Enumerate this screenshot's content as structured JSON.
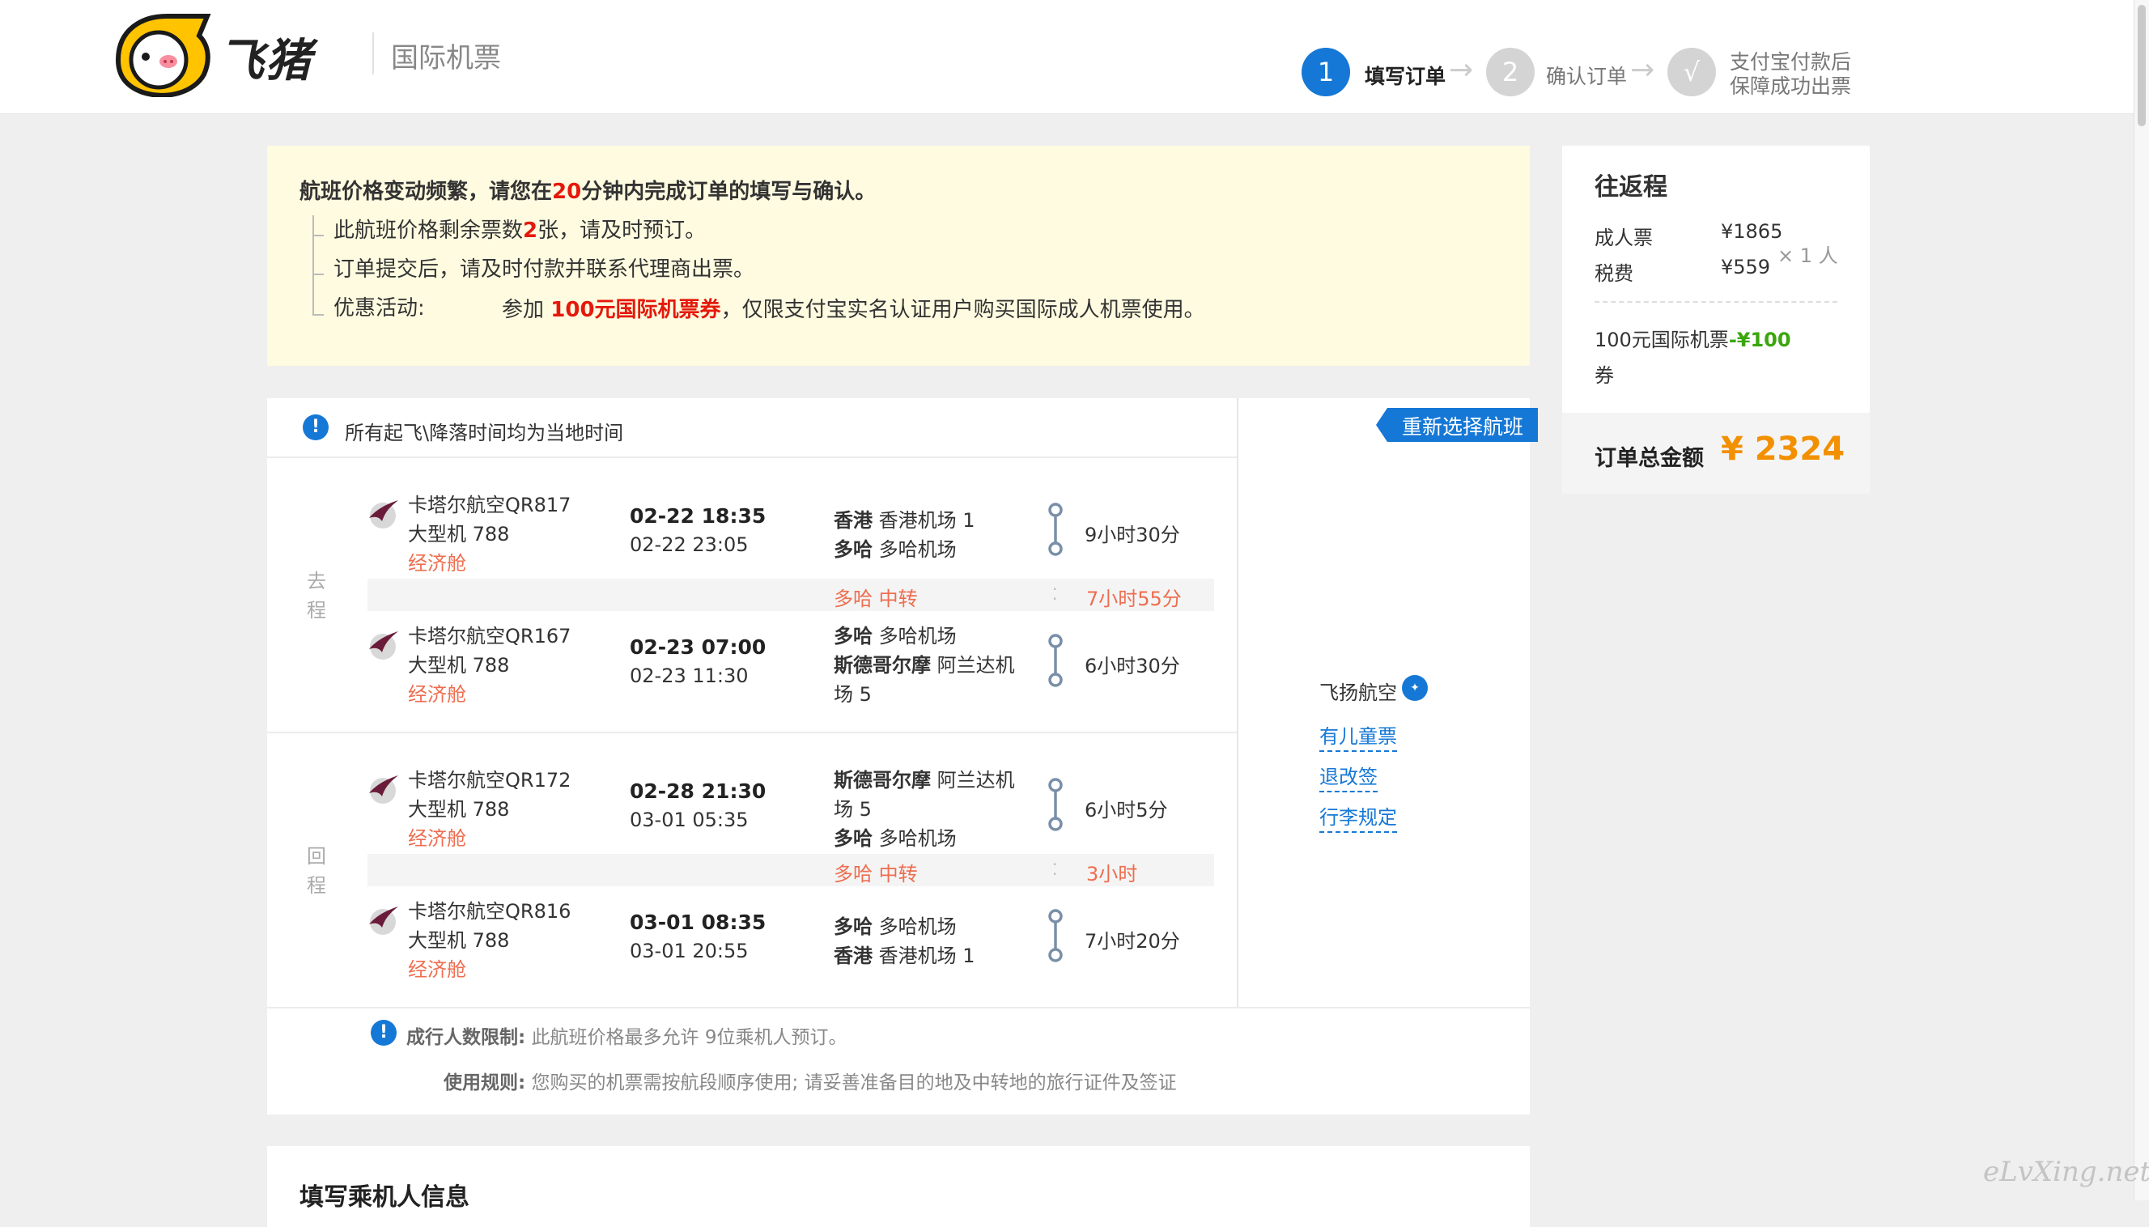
{
  "header": {
    "brand": "飞猪",
    "section": "国际机票",
    "steps": [
      {
        "num": "1",
        "label": "填写订单"
      },
      {
        "num": "2",
        "label": "确认订单"
      },
      {
        "num": "√",
        "label_line1": "支付宝付款后",
        "label_line2": "保障成功出票"
      }
    ],
    "arrow": "→"
  },
  "notice": {
    "line1_a": "航班价格变动频繁，请您在",
    "line1_b": "20",
    "line1_c": "分钟内完成订单的填写与确认。",
    "line2_a": "此航班价格剩余票数",
    "line2_b": "2",
    "line2_c": "张，请及时预订。",
    "line3": "订单提交后，请及时付款并联系代理商出票。",
    "line4_label": "优惠活动:",
    "line4_a": "参加",
    "line4_b": "100元国际机票券",
    "line4_c": "，仅限支付宝实名认证用户购买国际成人机票使用。"
  },
  "flights": {
    "timezone_note": "所有起飞\\降落时间均为当地时间",
    "reselect": "重新选择航班",
    "outbound_label": [
      "去",
      "程"
    ],
    "return_label": [
      "回",
      "程"
    ],
    "segments": [
      {
        "airline": "卡塔尔航空QR817",
        "aircraft": "大型机 788",
        "cabin": "经济舱",
        "dep_time": "02-22 18:35",
        "arr_time": "02-22 23:05",
        "dep_city": "香港",
        "dep_airport": "香港机场 1",
        "arr_city": "多哈",
        "arr_airport": "多哈机场",
        "duration": "9小时30分"
      },
      {
        "airline": "卡塔尔航空QR167",
        "aircraft": "大型机 788",
        "cabin": "经济舱",
        "dep_time": "02-23 07:00",
        "arr_time": "02-23 11:30",
        "dep_city": "多哈",
        "dep_airport": "多哈机场",
        "arr_city": "斯德哥尔摩",
        "arr_airport": "阿兰达机",
        "arr_airport2": "场 5",
        "duration": "6小时30分"
      },
      {
        "airline": "卡塔尔航空QR172",
        "aircraft": "大型机 788",
        "cabin": "经济舱",
        "dep_time": "02-28 21:30",
        "arr_time": "03-01 05:35",
        "dep_city": "斯德哥尔摩",
        "dep_airport": "阿兰达机",
        "dep_airport2": "场 5",
        "arr_city": "多哈",
        "arr_airport": "多哈机场",
        "duration": "6小时5分"
      },
      {
        "airline": "卡塔尔航空QR816",
        "aircraft": "大型机 788",
        "cabin": "经济舱",
        "dep_time": "03-01 08:35",
        "arr_time": "03-01 20:55",
        "dep_city": "多哈",
        "dep_airport": "多哈机场",
        "arr_city": "香港",
        "arr_airport": "香港机场 1",
        "duration": "7小时20分"
      }
    ],
    "transits": [
      {
        "place": "多哈 中转",
        "wait": "7小时55分"
      },
      {
        "place": "多哈 中转",
        "wait": "3小时"
      }
    ],
    "side": {
      "program": "飞扬航空",
      "links": [
        "有儿童票",
        "退改签",
        "行李规定"
      ]
    },
    "limit_label": "成行人数限制:",
    "limit_text": "此航班价格最多允许 9位乘机人预订。",
    "rule_label": "使用规则:",
    "rule_text": "您购买的机票需按航段顺序使用; 请妥善准备目的地及中转地的旅行证件及签证"
  },
  "summary": {
    "title": "往返程",
    "adult_label": "成人票",
    "adult_price": "¥1865",
    "tax_label": "税费",
    "tax_price": "¥559",
    "multiplier": "× 1 人",
    "coupon_label": "100元国际机票",
    "coupon_value": "-¥100",
    "coupon_label2": "券",
    "total_label": "订单总金额",
    "total_value": "¥ 2324"
  },
  "passenger": {
    "title": "填写乘机人信息"
  },
  "watermark": "eLvXing.net",
  "colors": {
    "accent_blue": "#1678d6",
    "price_orange": "#f29000",
    "alert_red": "#e4190c",
    "cabin_orange": "#ee6d4f",
    "coupon_green": "#3aa60c",
    "notice_bg": "#fefbe0"
  }
}
